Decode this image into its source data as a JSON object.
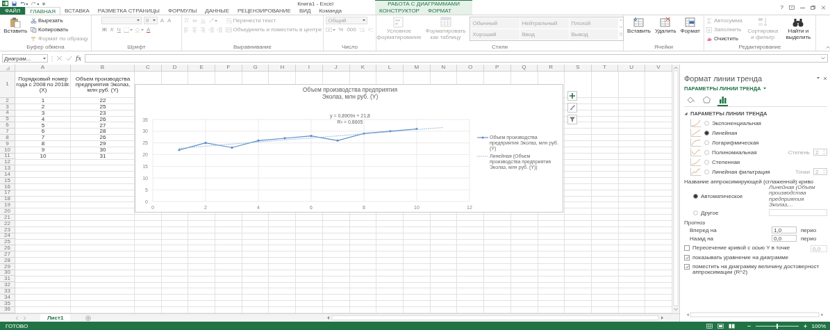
{
  "title_bar": {
    "title": "Книга1 - Excel",
    "context_group": "РАБОТА С ДИАГРАММАМИ",
    "help": "?"
  },
  "tabs": [
    {
      "label": "ФАЙЛ",
      "kind": "file",
      "selected": false
    },
    {
      "label": "ГЛАВНАЯ",
      "kind": "normal",
      "selected": true
    },
    {
      "label": "ВСТАВКА",
      "kind": "normal",
      "selected": false
    },
    {
      "label": "РАЗМЕТКА СТРАНИЦЫ",
      "kind": "normal",
      "selected": false
    },
    {
      "label": "ФОРМУЛЫ",
      "kind": "normal",
      "selected": false
    },
    {
      "label": "ДАННЫЕ",
      "kind": "normal",
      "selected": false
    },
    {
      "label": "РЕЦЕНЗИРОВАНИЕ",
      "kind": "normal",
      "selected": false
    },
    {
      "label": "ВИД",
      "kind": "normal",
      "selected": false
    },
    {
      "label": "Команда",
      "kind": "normal",
      "selected": false
    },
    {
      "label": "КОНСТРУКТОР",
      "kind": "context",
      "selected": false
    },
    {
      "label": "ФОРМАТ",
      "kind": "context",
      "selected": false
    }
  ],
  "ribbon": {
    "groups": [
      {
        "label": "Буфер обмена",
        "blocks": [
          {
            "kind": "large",
            "label": "Вставить",
            "disabled": false
          },
          {
            "kind": "stack",
            "rows": [
              {
                "items": [
                  {
                    "kind": "button",
                    "label": "Вырезать",
                    "disabled": false
                  }
                ]
              },
              {
                "items": [
                  {
                    "kind": "button",
                    "label": "Копировать",
                    "disabled": false
                  }
                ]
              },
              {
                "items": [
                  {
                    "kind": "button",
                    "label": "Формат по образцу",
                    "disabled": true
                  }
                ]
              }
            ]
          }
        ]
      },
      {
        "label": "Шрифт",
        "blocks": [
          {
            "kind": "stack",
            "rows": [
              {
                "items": [
                  {
                    "kind": "field",
                    "disabled": true
                  },
                  {
                    "kind": "field",
                    "value": "9",
                    "disabled": true
                  },
                  {
                    "kind": "glyph",
                    "label": "A",
                    "disabled": true
                  },
                  {
                    "kind": "glyph",
                    "label": "A",
                    "disabled": true
                  }
                ]
              },
              {
                "items": [
                  {
                    "kind": "glyph",
                    "label": "Ж",
                    "disabled": true
                  },
                  {
                    "kind": "glyph",
                    "label": "К",
                    "disabled": true
                  },
                  {
                    "kind": "glyph",
                    "label": "Ч",
                    "disabled": true
                  },
                  {
                    "kind": "button",
                    "disabled": true
                  },
                  {
                    "kind": "button",
                    "disabled": true
                  },
                  {
                    "kind": "glyph",
                    "label": "A",
                    "disabled": true
                  }
                ]
              }
            ]
          }
        ]
      },
      {
        "label": "Выравнивание",
        "blocks": [
          {
            "kind": "stack",
            "rows": [
              {
                "items": [
                  {
                    "kind": "button",
                    "disabled": true
                  },
                  {
                    "kind": "button",
                    "disabled": true
                  },
                  {
                    "kind": "button",
                    "disabled": true
                  },
                  {
                    "kind": "button",
                    "disabled": true
                  }
                ]
              },
              {
                "items": [
                  {
                    "kind": "button",
                    "disabled": true
                  },
                  {
                    "kind": "button",
                    "disabled": true
                  },
                  {
                    "kind": "button",
                    "disabled": true
                  },
                  {
                    "kind": "button",
                    "disabled": true
                  },
                  {
                    "kind": "button",
                    "disabled": true
                  }
                ]
              }
            ]
          },
          {
            "kind": "stack",
            "rows": [
              {
                "items": [
                  {
                    "kind": "button",
                    "label": "Перенести текст",
                    "disabled": true
                  }
                ]
              },
              {
                "items": [
                  {
                    "kind": "button",
                    "label": "Объединить и поместить в центре",
                    "disabled": true
                  }
                ]
              }
            ]
          }
        ]
      },
      {
        "label": "Число",
        "blocks": [
          {
            "kind": "stack",
            "rows": [
              {
                "items": [
                  {
                    "kind": "field",
                    "value": "Общий",
                    "disabled": true
                  }
                ]
              },
              {
                "items": [
                  {
                    "kind": "button",
                    "disabled": true
                  },
                  {
                    "kind": "glyph",
                    "label": "%",
                    "disabled": true
                  },
                  {
                    "kind": "glyph",
                    "label": "000",
                    "disabled": true
                  },
                  {
                    "kind": "button",
                    "disabled": true
                  },
                  {
                    "kind": "button",
                    "disabled": true
                  }
                ]
              }
            ]
          }
        ]
      },
      {
        "label": "Стили",
        "blocks": [
          {
            "kind": "large",
            "label": "Условное форматирование",
            "disabled": true
          },
          {
            "kind": "large",
            "label": "Форматировать как таблицу",
            "disabled": true
          },
          {
            "kind": "gallery",
            "items": [
              {
                "label": "Обычный",
                "disabled": true
              },
              {
                "label": "Нейтральный",
                "disabled": true
              },
              {
                "label": "Плохой",
                "disabled": true
              },
              {
                "label": "Хороший",
                "disabled": true
              },
              {
                "label": "Ввод",
                "disabled": true
              },
              {
                "label": "Вывод",
                "disabled": true
              }
            ]
          }
        ]
      },
      {
        "label": "Ячейки",
        "blocks": [
          {
            "kind": "large",
            "label": "Вставить",
            "disabled": false
          },
          {
            "kind": "large",
            "label": "Удалить",
            "disabled": false
          },
          {
            "kind": "large",
            "label": "Формат",
            "disabled": false
          }
        ]
      },
      {
        "label": "Редактирование",
        "blocks": [
          {
            "kind": "stack",
            "rows": [
              {
                "items": [
                  {
                    "kind": "button",
                    "label": "Автосумма",
                    "disabled": true
                  }
                ]
              },
              {
                "items": [
                  {
                    "kind": "button",
                    "label": "Заполнить",
                    "disabled": true
                  }
                ]
              },
              {
                "items": [
                  {
                    "kind": "button",
                    "label": "Очистить",
                    "disabled": false
                  }
                ]
              }
            ]
          },
          {
            "kind": "large",
            "label": "Сортировка и фильтр",
            "disabled": true
          },
          {
            "kind": "large",
            "label": "Найти и выделить",
            "disabled": false
          }
        ]
      }
    ]
  },
  "formula_bar": {
    "name_box": "Диаграм...",
    "function_label": "fx"
  },
  "sheet": {
    "columns": [
      "A",
      "B",
      "C",
      "D",
      "E",
      "F",
      "G",
      "H",
      "I",
      "J",
      "K",
      "L",
      "M",
      "N",
      "O",
      "P",
      "Q",
      "R",
      "S",
      "T",
      "U",
      "V"
    ],
    "rows": [
      {
        "number": "1",
        "cells": [
          "Порядковый номер года с 2008 по 2018г. (X)",
          "Объем производства предприятия Эколаз, млн руб. (Y)"
        ]
      },
      {
        "number": "2",
        "cells": [
          "1",
          "22"
        ]
      },
      {
        "number": "3",
        "cells": [
          "2",
          "25"
        ]
      },
      {
        "number": "4",
        "cells": [
          "3",
          "23"
        ]
      },
      {
        "number": "5",
        "cells": [
          "4",
          "26"
        ]
      },
      {
        "number": "6",
        "cells": [
          "5",
          "27"
        ]
      },
      {
        "number": "7",
        "cells": [
          "6",
          "28"
        ]
      },
      {
        "number": "8",
        "cells": [
          "7",
          "26"
        ]
      },
      {
        "number": "9",
        "cells": [
          "8",
          "29"
        ]
      },
      {
        "number": "10",
        "cells": [
          "9",
          "30"
        ]
      },
      {
        "number": "11",
        "cells": [
          "10",
          "31"
        ]
      },
      {
        "number": "12"
      },
      {
        "number": "13"
      },
      {
        "number": "14"
      },
      {
        "number": "15"
      },
      {
        "number": "16"
      },
      {
        "number": "17"
      },
      {
        "number": "18"
      },
      {
        "number": "19"
      },
      {
        "number": "20"
      },
      {
        "number": "21"
      },
      {
        "number": "22"
      },
      {
        "number": "23"
      },
      {
        "number": "24"
      },
      {
        "number": "25"
      },
      {
        "number": "26"
      },
      {
        "number": "27"
      },
      {
        "number": "28"
      },
      {
        "number": "29"
      },
      {
        "number": "30"
      },
      {
        "number": "31"
      },
      {
        "number": "32"
      },
      {
        "number": "33"
      },
      {
        "number": "34"
      },
      {
        "number": "35"
      },
      {
        "number": "36"
      }
    ],
    "chart": {
      "chart_data": {
        "type": "line",
        "title": "Объем производства предприятия Эколаз, млн руб. (Y)",
        "x": [
          1,
          2,
          3,
          4,
          5,
          6,
          7,
          8,
          9,
          10,
          11
        ],
        "xlim": [
          0,
          12
        ],
        "ylim": [
          0,
          35
        ],
        "xticks": [
          0,
          2,
          4,
          6,
          8,
          10,
          12
        ],
        "yticks": [
          0,
          5,
          10,
          15,
          20,
          25,
          30,
          35
        ],
        "grid": true,
        "legend": "right",
        "series": [
          {
            "name": "Объем производства предприятия Эколаз, млн руб. (Y)",
            "color": "#5b8bc6",
            "line_style": "solid",
            "values": [
              22,
              25,
              23,
              26,
              27,
              28,
              26,
              29,
              30,
              31,
              null
            ]
          },
          {
            "name": "Линейная (Объем производства предприятия Эколаз, млн руб. (Y))",
            "color": "#8fb6e0",
            "line_style": "dotted",
            "values": [
              22.7,
              23.6,
              24.5,
              25.4,
              26.3,
              27.1,
              28.0,
              28.9,
              29.8,
              30.7,
              31.6
            ]
          }
        ],
        "annotations": [
          "y = 0,8909x + 21,8",
          "R² = 0,8605"
        ]
      }
    },
    "sheet_tabs": [
      {
        "label": "Лист1",
        "selected": true
      }
    ]
  },
  "pane": {
    "title": "Формат линии тренда",
    "subtitle": "ПАРАМЕТРЫ ЛИНИИ ТРЕНДА",
    "icon_tabs": [
      {
        "kind": "fill",
        "selected": false
      },
      {
        "kind": "effects",
        "selected": false
      },
      {
        "kind": "options",
        "selected": true
      }
    ],
    "section": {
      "label": "ПАРАМЕТРЫ ЛИНИИ ТРЕНДА",
      "expanded": true
    },
    "trend_types": [
      {
        "kind": "exponential",
        "label": "Экспоненциальная",
        "selected": false
      },
      {
        "kind": "linear",
        "label": "Линейная",
        "selected": true
      },
      {
        "kind": "logarithmic",
        "label": "Логарифмическая",
        "selected": false
      },
      {
        "kind": "polynomial",
        "label": "Полиномиальная",
        "selected": false,
        "option": {
          "label": "Степень",
          "value": "2",
          "disabled": true
        }
      },
      {
        "kind": "power",
        "label": "Степенная",
        "selected": false
      },
      {
        "kind": "moving_average",
        "label": "Линейная фильтрация",
        "selected": false,
        "option": {
          "label": "Точки",
          "value": "2",
          "disabled": true
        }
      }
    ],
    "name_label": "Название аппроксимирующей (сглаженной) криво",
    "name_options": [
      {
        "kind": "auto",
        "label": "Автоматическое",
        "selected": true,
        "value": "Линейная (Объем производства предприятия Эколаз,..."
      },
      {
        "kind": "custom",
        "label": "Другое",
        "selected": false
      }
    ],
    "forecast_label": "Прогноз",
    "forecast": [
      {
        "label": "Вперед на",
        "value": "1,0",
        "unit": "перио"
      },
      {
        "label": "Назад на",
        "value": "0,0",
        "unit": "перио"
      }
    ],
    "checkboxes": [
      {
        "label": "Пересечение кривой с осью Y в точке",
        "checked": false,
        "value": "0,0"
      },
      {
        "label": "показывать уравнение на диаграмме",
        "checked": true
      },
      {
        "label": "поместить на диаграмму величину достоверност аппроксимации (R^2)",
        "checked": true
      }
    ]
  },
  "status_bar": {
    "text": "ГОТОВО",
    "zoom": {
      "level": 0.5,
      "label": "100%"
    }
  }
}
